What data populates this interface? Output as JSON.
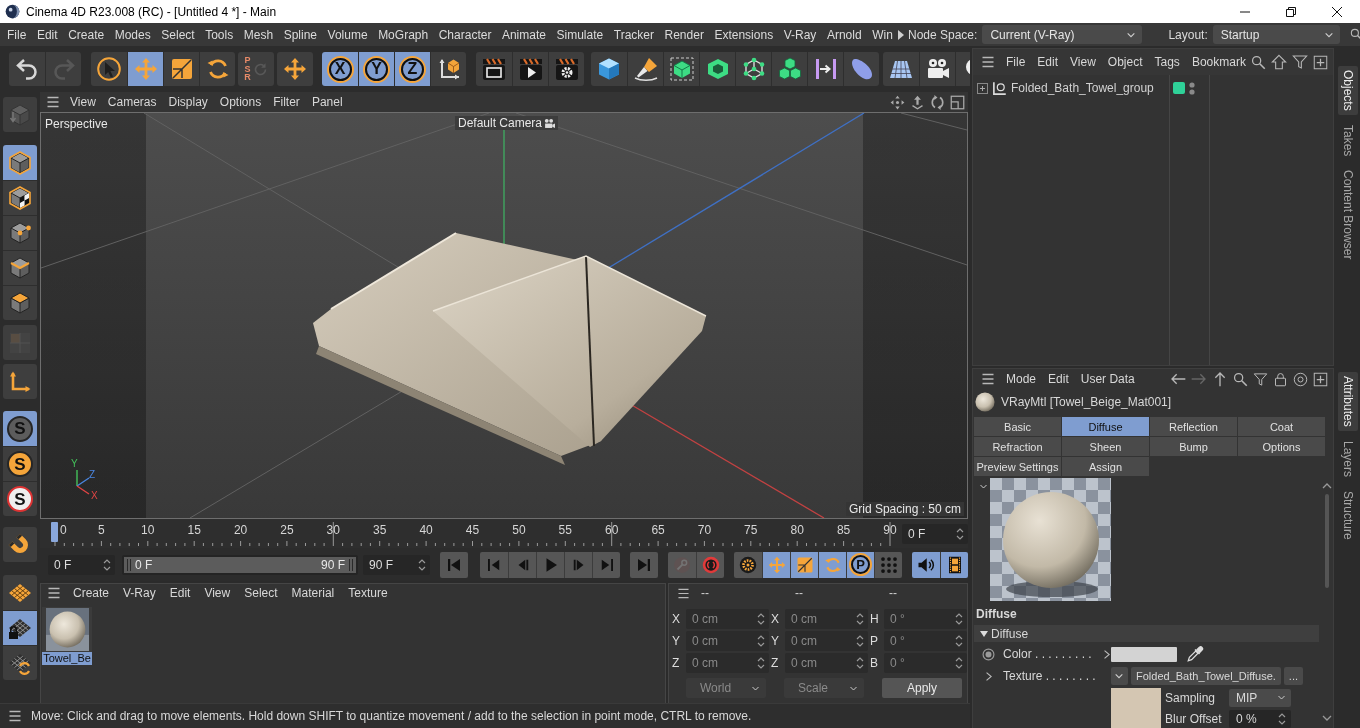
{
  "window": {
    "title": "Cinema 4D R23.008 (RC) - [Untitled 4 *] - Main"
  },
  "menu_bar": {
    "items": [
      "File",
      "Edit",
      "Create",
      "Modes",
      "Select",
      "Tools",
      "Mesh",
      "Spline",
      "Volume",
      "MoGraph",
      "Character",
      "Animate",
      "Simulate",
      "Tracker",
      "Render",
      "Extensions",
      "V-Ray",
      "Arnold",
      "Win"
    ],
    "node_space": {
      "label": "Node Space:",
      "value": "Current (V-Ray)"
    },
    "layout": {
      "label": "Layout:",
      "value": "Startup"
    }
  },
  "toolbar": {
    "groups": [
      [
        {
          "kind": "undo",
          "on": false,
          "disabled": false
        },
        {
          "kind": "redo",
          "on": false,
          "disabled": true
        }
      ],
      [
        {
          "kind": "select",
          "on": false,
          "disabled": false
        },
        {
          "kind": "move",
          "on": true,
          "disabled": false
        },
        {
          "kind": "scale",
          "on": false,
          "disabled": false
        },
        {
          "kind": "rotate",
          "on": false,
          "disabled": false
        }
      ],
      [
        {
          "kind": "psr",
          "label": "PSR",
          "on": false,
          "disabled": true
        }
      ],
      [
        {
          "kind": "transform",
          "on": false,
          "disabled": false
        }
      ],
      [
        {
          "kind": "axis",
          "label": "X",
          "on": true,
          "disabled": false
        },
        {
          "kind": "axis",
          "label": "Y",
          "on": true,
          "disabled": false
        },
        {
          "kind": "axis",
          "label": "Z",
          "on": true,
          "disabled": false
        },
        {
          "kind": "system",
          "on": false,
          "disabled": false
        }
      ],
      [
        {
          "kind": "renderview",
          "on": false,
          "disabled": false
        },
        {
          "kind": "render",
          "on": false,
          "disabled": false
        },
        {
          "kind": "rendersettings",
          "on": false,
          "disabled": false
        }
      ],
      [
        {
          "kind": "cube",
          "on": false,
          "disabled": false
        },
        {
          "kind": "pen",
          "on": false,
          "disabled": false
        },
        {
          "kind": "subdivision",
          "on": false,
          "disabled": false
        },
        {
          "kind": "extrude",
          "on": false,
          "disabled": false
        },
        {
          "kind": "cloner",
          "on": false,
          "disabled": false
        },
        {
          "kind": "array",
          "on": false,
          "disabled": false
        },
        {
          "kind": "deformer",
          "on": false,
          "disabled": false
        },
        {
          "kind": "field",
          "on": false,
          "disabled": false
        }
      ],
      [
        {
          "kind": "floor",
          "on": false,
          "disabled": false
        },
        {
          "kind": "camera",
          "on": false,
          "disabled": false
        },
        {
          "kind": "light",
          "on": false,
          "disabled": false
        }
      ]
    ]
  },
  "left_toolbar": {
    "groups": [
      [
        {
          "kind": "editable",
          "on": false,
          "disabled": true
        }
      ],
      [
        {
          "kind": "model",
          "on": true,
          "disabled": false
        },
        {
          "kind": "texture",
          "on": false,
          "disabled": false
        },
        {
          "kind": "points",
          "on": false,
          "disabled": false
        },
        {
          "kind": "edges",
          "on": false,
          "disabled": false
        },
        {
          "kind": "polygons",
          "on": false,
          "disabled": false
        }
      ],
      [
        {
          "kind": "uv",
          "on": false,
          "disabled": true
        }
      ],
      [
        {
          "kind": "axismode",
          "on": false,
          "disabled": false
        }
      ],
      [
        {
          "kind": "snap",
          "label": "S",
          "on": true,
          "disabled": false
        },
        {
          "kind": "autosnap",
          "label": "S",
          "on": false,
          "disabled": false
        },
        {
          "kind": "locksnap",
          "label": "S",
          "on": false,
          "disabled": false
        }
      ],
      [
        {
          "kind": "magnet",
          "on": false,
          "disabled": false
        }
      ],
      [
        {
          "kind": "workplane",
          "on": false,
          "disabled": false
        },
        {
          "kind": "workplanelock",
          "on": true,
          "disabled": false
        },
        {
          "kind": "workplanealign",
          "on": false,
          "disabled": false
        }
      ]
    ]
  },
  "viewport": {
    "menu": [
      "View",
      "Cameras",
      "Display",
      "Options",
      "Filter",
      "Panel"
    ],
    "view_name": "Perspective",
    "camera": "Default Camera",
    "grid_spacing": "Grid Spacing : 50 cm",
    "axis_labels": [
      "Y",
      "Z",
      "X"
    ]
  },
  "timeline": {
    "ticks": [
      "0",
      "5",
      "10",
      "15",
      "20",
      "25",
      "30",
      "35",
      "40",
      "45",
      "50",
      "55",
      "60",
      "65",
      "70",
      "75",
      "80",
      "85",
      "90"
    ],
    "playhead": {
      "level": 0
    },
    "current_frame": "0 F",
    "start_field": "0 F",
    "range": {
      "start": "0 F",
      "end": "90 F",
      "level": 1
    },
    "end_field": "90 F",
    "groups": [
      [
        {
          "kind": "start",
          "on": false,
          "disabled": false
        }
      ],
      [
        {
          "kind": "prevkey",
          "on": false,
          "disabled": false
        },
        {
          "kind": "prevframe",
          "on": false,
          "disabled": false
        },
        {
          "kind": "play",
          "on": false,
          "disabled": false
        },
        {
          "kind": "nextframe",
          "on": false,
          "disabled": false
        },
        {
          "kind": "nextkey",
          "on": false,
          "disabled": false
        }
      ],
      [
        {
          "kind": "end",
          "on": false,
          "disabled": false
        }
      ],
      [
        {
          "kind": "record",
          "on": false,
          "disabled": true
        },
        {
          "kind": "autokey",
          "on": false,
          "disabled": false
        }
      ],
      [
        {
          "kind": "keyset",
          "on": false,
          "disabled": false
        },
        {
          "kind": "keymove",
          "on": true,
          "disabled": false
        },
        {
          "kind": "keyscale",
          "on": true,
          "disabled": false
        },
        {
          "kind": "keyrotate",
          "on": true,
          "disabled": false
        },
        {
          "kind": "param",
          "label": "P",
          "on": true,
          "disabled": false
        },
        {
          "kind": "pla",
          "on": false,
          "disabled": false
        }
      ],
      [
        {
          "kind": "sound",
          "on": true,
          "disabled": false
        },
        {
          "kind": "film",
          "on": true,
          "disabled": false
        }
      ]
    ]
  },
  "materials": {
    "menu": [
      "Create",
      "V-Ray",
      "Edit",
      "View",
      "Select",
      "Material",
      "Texture"
    ],
    "items": [
      {
        "name": "Towel_Be",
        "selected": true
      }
    ]
  },
  "coordinates": {
    "disabled": true,
    "headers": [
      "--",
      "--",
      "--"
    ],
    "columns": [
      [
        {
          "label": "X",
          "value": "0 cm"
        },
        {
          "label": "Y",
          "value": "0 cm"
        },
        {
          "label": "Z",
          "value": "0 cm"
        }
      ],
      [
        {
          "label": "X",
          "value": "0 cm"
        },
        {
          "label": "Y",
          "value": "0 cm"
        },
        {
          "label": "Z",
          "value": "0 cm"
        }
      ],
      [
        {
          "label": "H",
          "value": "0 °"
        },
        {
          "label": "P",
          "value": "0 °"
        },
        {
          "label": "B",
          "value": "0 °"
        }
      ]
    ],
    "dropdowns": [
      "World",
      "Scale"
    ],
    "apply": "Apply"
  },
  "status_bar": {
    "text": "Move: Click and drag to move elements. Hold down SHIFT to quantize movement / add to the selection in point mode, CTRL to remove."
  },
  "objects": {
    "menu": [
      "File",
      "Edit",
      "View",
      "Object",
      "Tags",
      "Bookmark"
    ],
    "items": [
      {
        "name": "Folded_Bath_Towel_group",
        "expanded": false,
        "selected": false
      }
    ]
  },
  "attributes": {
    "menu": [
      "Mode",
      "Edit",
      "User Data"
    ],
    "title": "VRayMtl [Towel_Beige_Mat001]",
    "tabs": [
      {
        "label": "Basic",
        "selected": false
      },
      {
        "label": "Diffuse",
        "selected": true
      },
      {
        "label": "Reflection",
        "selected": false
      },
      {
        "label": "Coat",
        "selected": false
      },
      {
        "label": "Refraction",
        "selected": false
      },
      {
        "label": "Sheen",
        "selected": false
      },
      {
        "label": "Bump",
        "selected": false
      },
      {
        "label": "Options",
        "selected": false
      },
      {
        "label": "Preview Settings",
        "selected": false
      },
      {
        "label": "Assign",
        "selected": false
      }
    ],
    "section": "Diffuse",
    "group": {
      "label": "Diffuse",
      "expanded": true
    },
    "color_param": {
      "label": "Color . . . . . . . . ."
    },
    "texture_param": {
      "label": "Texture . . . . . . . .",
      "file": "Folded_Bath_Towel_Diffuse.",
      "more": "..."
    },
    "sampling": {
      "label": "Sampling",
      "value": "MIP"
    },
    "blur_offset": {
      "label": "Blur Offset",
      "value": "0 %"
    }
  },
  "side_tabs": {
    "top": [
      {
        "label": "Objects",
        "selected": true
      },
      {
        "label": "Takes",
        "selected": false
      },
      {
        "label": "Content Browser",
        "selected": false
      }
    ],
    "bottom": [
      {
        "label": "Attributes",
        "selected": true
      },
      {
        "label": "Layers",
        "selected": false
      },
      {
        "label": "Structure",
        "selected": false
      }
    ]
  }
}
